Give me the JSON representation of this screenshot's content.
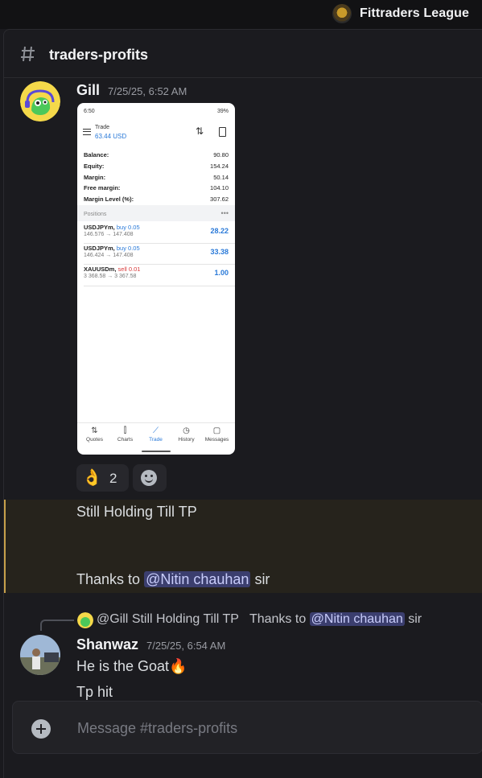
{
  "server": {
    "name": "Fittraders League"
  },
  "channel": {
    "name": "traders-profits"
  },
  "messages": [
    {
      "author": "Gill",
      "timestamp": "7/25/25, 6:52 AM",
      "reactions": [
        {
          "emoji": "👌",
          "count": "2"
        }
      ],
      "body_line1": "Still Holding Till TP",
      "body_line2_prefix": "Thanks to",
      "body_mention": "@Nitin chauhan",
      "body_line2_suffix": "sir"
    },
    {
      "author": "Shanwaz",
      "timestamp": "7/25/25, 6:54 AM",
      "reply": {
        "author_mention": "@Gill",
        "text": "Still Holding Till TP",
        "thanks": "Thanks to",
        "mention": "@Nitin chauhan",
        "suffix": "sir"
      },
      "line1": "He is the Goat",
      "line1_emoji": "🔥",
      "line2": "Tp hit"
    }
  ],
  "attachment": {
    "status_time": "6:50",
    "status_right": "39%",
    "header_title": "Trade",
    "header_value": "63.44 USD",
    "account": [
      {
        "label": "Balance:",
        "value": "90.80"
      },
      {
        "label": "Equity:",
        "value": "154.24"
      },
      {
        "label": "Margin:",
        "value": "50.14"
      },
      {
        "label": "Free margin:",
        "value": "104.10"
      },
      {
        "label": "Margin Level (%):",
        "value": "307.62"
      }
    ],
    "positions_header": "Positions",
    "positions": [
      {
        "symbol": "USDJPYm,",
        "side": "buy 0.05",
        "prices": "146.576 → 147.408",
        "profit": "28.22"
      },
      {
        "symbol": "USDJPYm,",
        "side": "buy 0.05",
        "prices": "146.424 → 147.408",
        "profit": "33.38"
      },
      {
        "symbol": "XAUUSDm,",
        "side": "sell 0.01",
        "prices": "3 368.58 → 3 367.58",
        "profit": "1.00"
      }
    ],
    "nav": [
      "Quotes",
      "Charts",
      "Trade",
      "History",
      "Messages"
    ]
  },
  "composer": {
    "placeholder": "Message #traders-profits"
  }
}
